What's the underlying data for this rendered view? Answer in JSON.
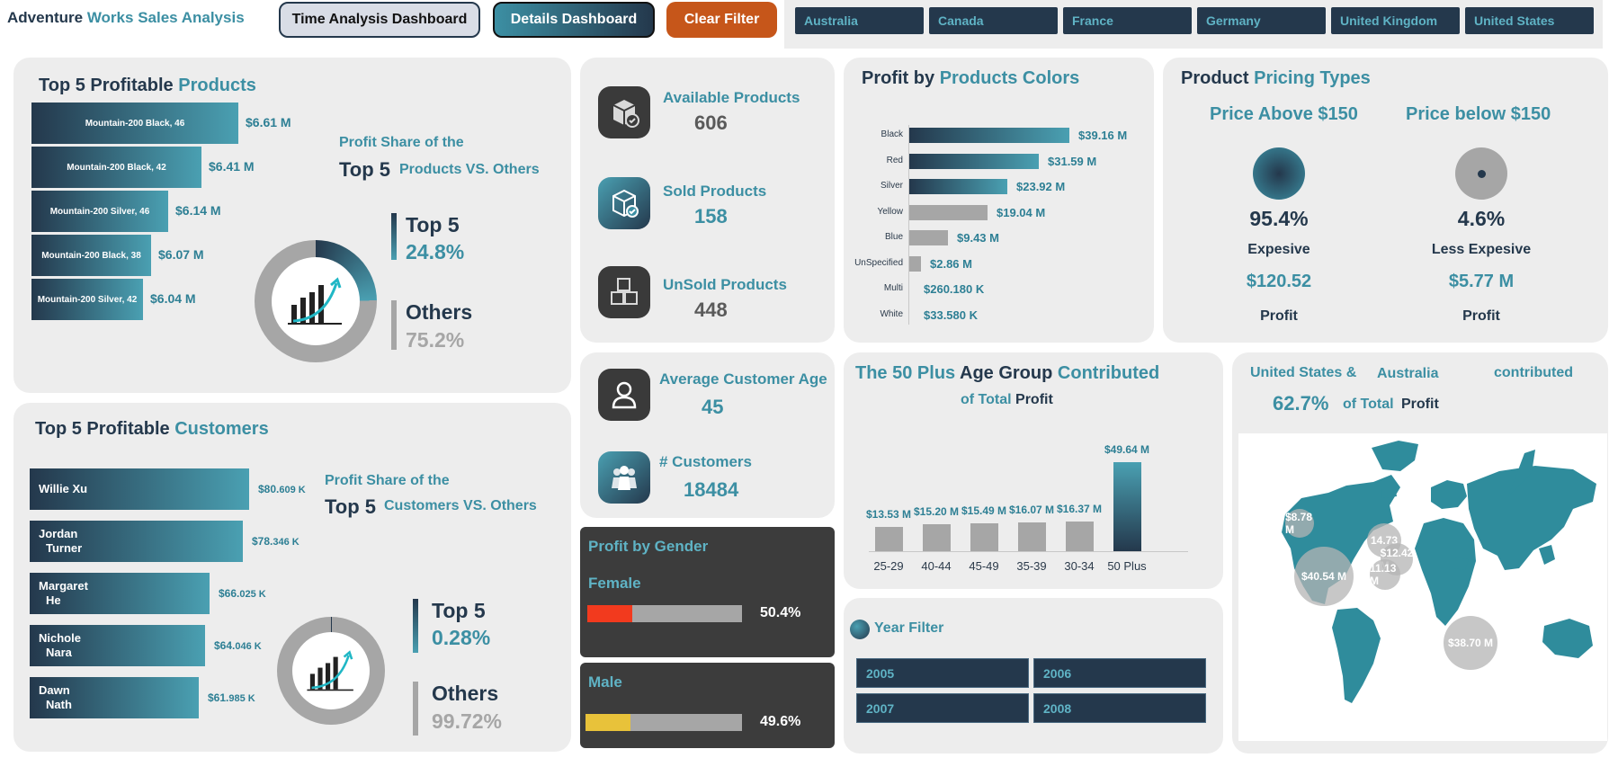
{
  "header": {
    "title_part1": "Adventure",
    "title_part2": "Works",
    "title_part3": "Sales Analysis",
    "btn_time": "Time Analysis Dashboard",
    "btn_details": "Details Dashboard",
    "btn_clear": "Clear Filter",
    "countries": [
      "Australia",
      "Canada",
      "France",
      "Germany",
      "United Kingdom",
      "United States"
    ]
  },
  "products": {
    "title_a": "Top 5",
    "title_b": "Profitable",
    "title_c": "Products",
    "items": [
      {
        "label": "Mountain-200 Black, 46",
        "value": "$6.61 M",
        "share": 1.0
      },
      {
        "label": "Mountain-200 Black, 42",
        "value": "$6.41 M",
        "share": 0.82
      },
      {
        "label": "Mountain-200 Silver, 46",
        "value": "$6.14 M",
        "share": 0.66
      },
      {
        "label": "Mountain-200 Black, 38",
        "value": "$6.07 M",
        "share": 0.58
      },
      {
        "label": "Mountain-200 Silver, 42",
        "value": "$6.04 M",
        "share": 0.54
      }
    ],
    "share_line1": "Profit Share of the",
    "share_big": "Top 5",
    "share_line2": "Products VS. Others",
    "top_label": "Top 5",
    "top_pct": "24.8%",
    "others_label": "Others",
    "others_pct": "75.2%",
    "top_fraction": 0.248
  },
  "customers": {
    "title_a": "Top 5",
    "title_b": "Profitable",
    "title_c": "Customers",
    "items": [
      {
        "label_line1": "Willie Xu",
        "label_line2": "",
        "value_main": "$80.",
        "value_small": "609 K",
        "share": 1.0
      },
      {
        "label_line1": "Jordan",
        "label_line2": "Turner",
        "value_main": "$78.",
        "value_small": "346 K",
        "share": 0.97
      },
      {
        "label_line1": "Margaret",
        "label_line2": "He",
        "value_main": "$66.",
        "value_small": "025 K",
        "share": 0.82
      },
      {
        "label_line1": "Nichole",
        "label_line2": "Nara",
        "value_main": "$64.",
        "value_small": "046 K",
        "share": 0.8
      },
      {
        "label_line1": "Dawn",
        "label_line2": "Nath",
        "value_main": "$61.",
        "value_small": "985 K",
        "share": 0.77
      }
    ],
    "share_line1": "Profit Share of the",
    "share_big": "Top 5",
    "share_line2": "Customers VS. Others",
    "top_label": "Top 5",
    "top_pct": "0.28%",
    "others_label": "Others",
    "others_pct": "99.72%",
    "top_fraction": 0.0028
  },
  "kpis": {
    "available_label": "Available Products",
    "available_value": "606",
    "sold_label": "Sold Products",
    "sold_value": "158",
    "unsold_label": "UnSold Products",
    "unsold_value": "448",
    "age_label": "Average Customer Age",
    "age_value": "45",
    "customers_label": "# Customers",
    "customers_value": "18484"
  },
  "colors_chart": {
    "title_a": "Profit by",
    "title_b": "Products Colors",
    "chart_data": {
      "type": "bar",
      "categories": [
        "Black",
        "Red",
        "Silver",
        "Yellow",
        "Blue",
        "UnSpecified",
        "Multi",
        "White"
      ],
      "values": [
        39.16,
        31.59,
        23.92,
        19.04,
        9.43,
        2.86,
        0.26018,
        0.03358
      ],
      "labels": [
        "$39.16 M",
        "$31.59 M",
        "$23.92 M",
        "$19.04 M",
        "$9.43 M",
        "$2.86 M",
        "$260.180 K",
        "$33.580 K"
      ]
    }
  },
  "pricing": {
    "title_a": "Product",
    "title_b": "Pricing Types",
    "above_label": "Price Above  $150",
    "below_label": "Price below  $150",
    "above_pct": "95.4%",
    "below_pct": "4.6%",
    "above_type": "Expesive",
    "below_type": "Less Expesive",
    "above_profit": "$120.52",
    "below_profit": "$5.77 M",
    "profit_label": "Profit"
  },
  "age_chart": {
    "title_a": "The 50",
    "title_b": "Plus",
    "title_c": "Age Group",
    "title_d": "Contributed",
    "subtitle_a": "of Total",
    "subtitle_b": "Profit",
    "chart_data": {
      "type": "bar",
      "categories": [
        "25-29",
        "40-44",
        "45-49",
        "35-39",
        "30-34",
        "50 Plus"
      ],
      "values": [
        13.53,
        15.2,
        15.49,
        16.07,
        16.37,
        49.64
      ],
      "labels": [
        "$13.53 M",
        "$15.20 M",
        "$15.49 M",
        "$16.07 M",
        "$16.37 M",
        "$49.64 M"
      ]
    }
  },
  "gender": {
    "title": "Profit by Gender",
    "female_label": "Female",
    "female_pct": "50.4%",
    "female_fraction": 0.504,
    "male_label": "Male",
    "male_pct": "49.6%",
    "male_fraction": 0.496,
    "female_color": "#f23a1e",
    "male_color": "#e8c23a"
  },
  "year_filter": {
    "title": "Year Filter",
    "years": [
      "2005",
      "2006",
      "2007",
      "2008"
    ]
  },
  "map": {
    "line1_a": "United States &",
    "line1_b": "Australia",
    "line1_c": "contributed",
    "pct": "62.7%",
    "of_total": "of Total",
    "profit": "Profit",
    "bubbles": [
      "$8.78 M",
      "$40.54 M",
      "14.73",
      "$12.42 M",
      "11.13 M",
      "$38.70 M"
    ]
  }
}
